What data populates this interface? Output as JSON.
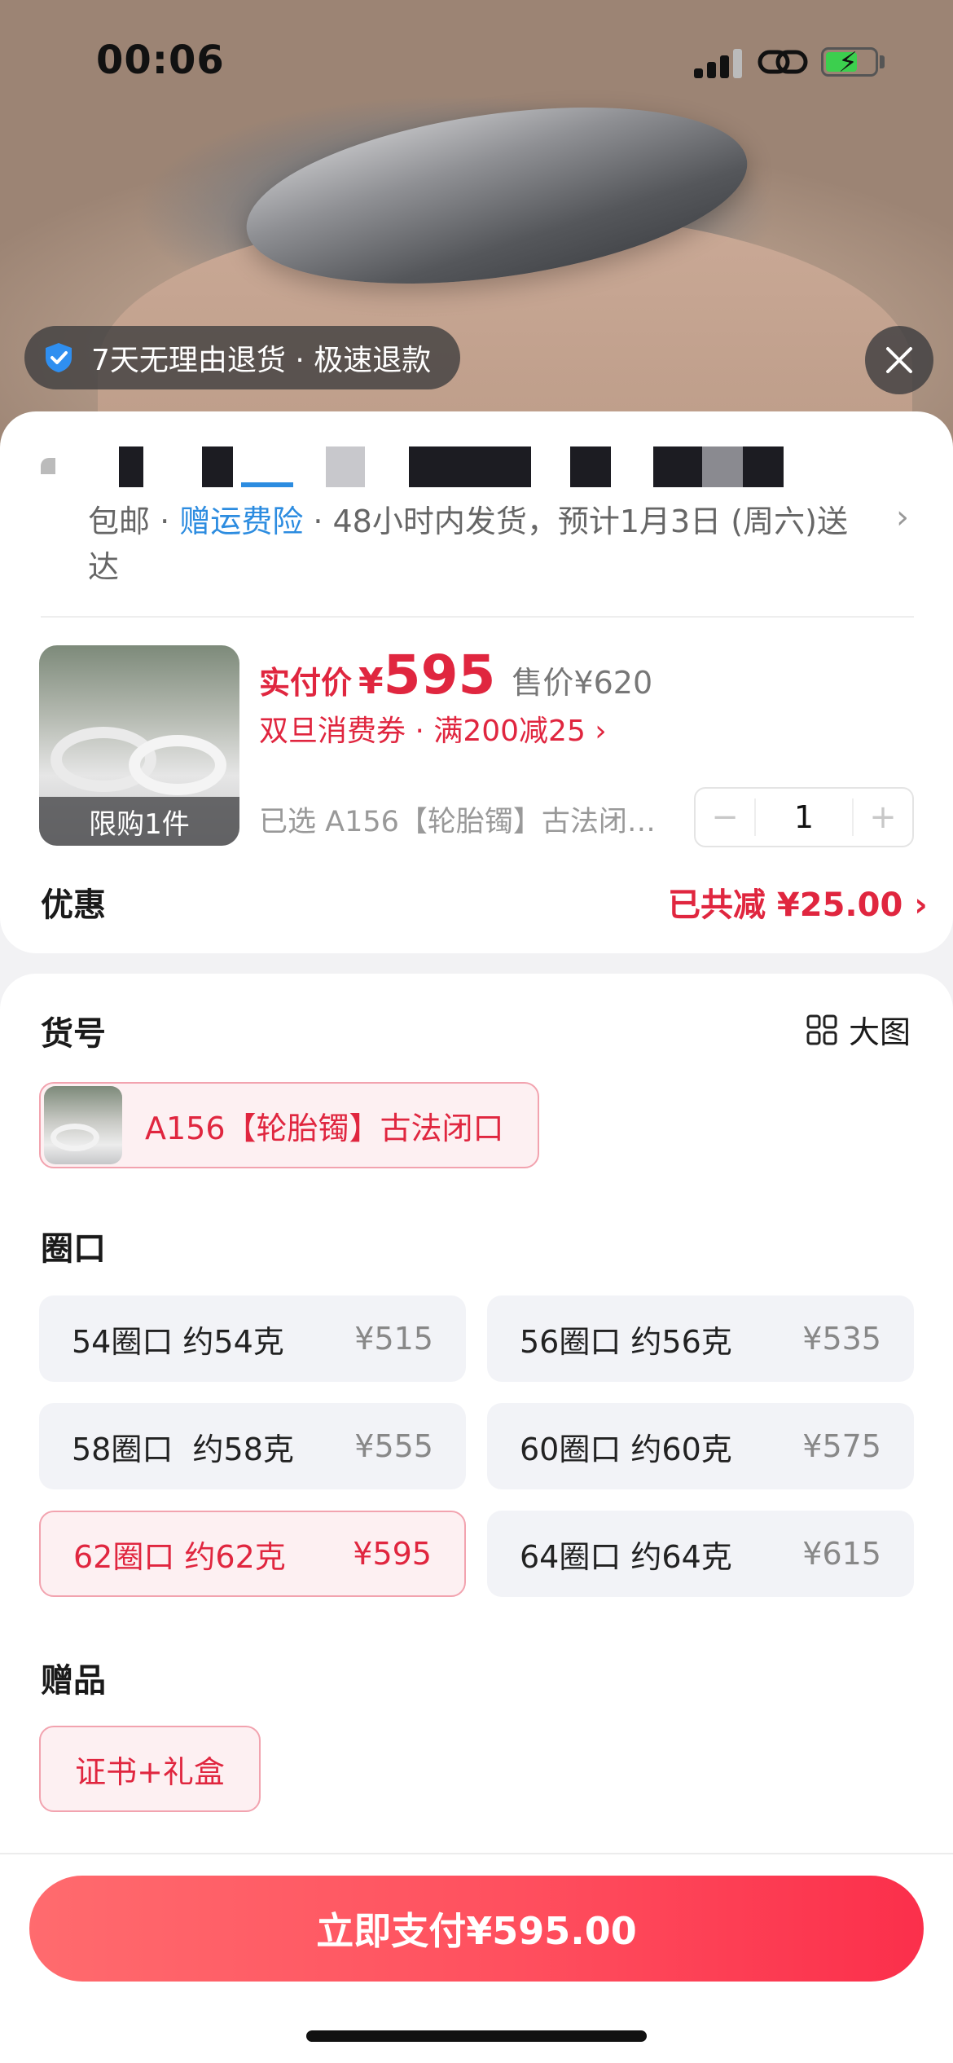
{
  "status": {
    "time": "00:06"
  },
  "banner": {
    "return_policy": "7天无理由退货 · 极速退款"
  },
  "shipping": {
    "prefix": "包邮 · ",
    "insurance": "赠运费险",
    "text": " · 48小时内发货，预计1月3日 (周六)送达"
  },
  "product": {
    "limit_label": "限购1件",
    "price_label": "实付价",
    "price_currency": "¥",
    "price_value": "595",
    "original_price": "售价¥620",
    "coupon": "双旦消费券 · 满200减25 ›",
    "selected": "已选 A156【轮胎镯】古法闭…",
    "quantity": "1",
    "minus": "−",
    "plus": "+"
  },
  "discount": {
    "label": "优惠",
    "value": "已共减 ¥25.00 ›"
  },
  "sku": {
    "title": "货号",
    "big_image": "大图",
    "option": "A156【轮胎镯】古法闭口"
  },
  "sizes": {
    "title": "圈口",
    "options": [
      {
        "label": "54圈口 约54克",
        "price": "¥515",
        "selected": false
      },
      {
        "label": "56圈口 约56克",
        "price": "¥535",
        "selected": false
      },
      {
        "label": "58圈口  约58克",
        "price": "¥555",
        "selected": false
      },
      {
        "label": "60圈口 约60克",
        "price": "¥575",
        "selected": false
      },
      {
        "label": "62圈口 约62克",
        "price": "¥595",
        "selected": true
      },
      {
        "label": "64圈口 约64克",
        "price": "¥615",
        "selected": false
      }
    ]
  },
  "gift": {
    "title": "赠品",
    "option": "证书+礼盒"
  },
  "pay": {
    "label": "立即支付¥595.00"
  },
  "colors": {
    "accent": "#e0263f",
    "link": "#2c8ce0",
    "pay_gradient_end": "#fb2f4b"
  }
}
